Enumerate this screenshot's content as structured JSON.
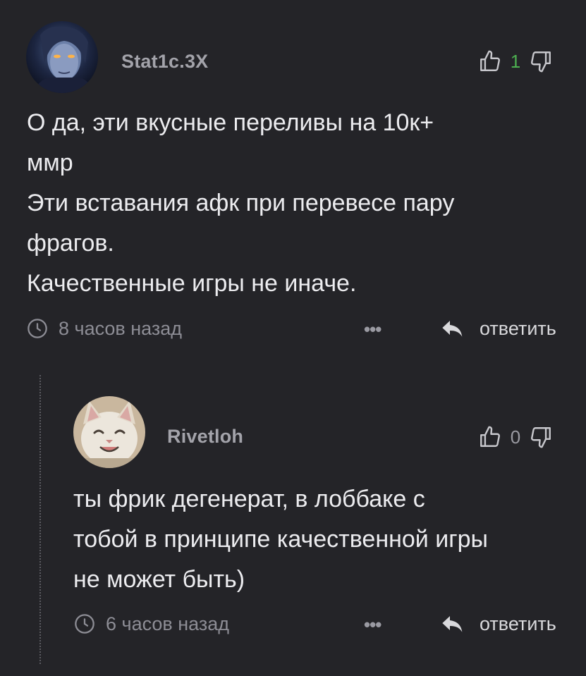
{
  "comments": [
    {
      "username": "Stat1c.3X",
      "rating": "1",
      "rating_color": "#4caf50",
      "text_lines": [
        "О да, эти вкусные переливы на 10к+",
        "ммр",
        "Эти вставания афк при перевесе пару",
        "фрагов.",
        "Качественные игры не иначе."
      ],
      "time": "8 часов назад",
      "more": "•••",
      "reply_label": "ответить",
      "icons": {
        "upvote": "thumbs-up-icon",
        "downvote": "thumbs-down-icon",
        "clock": "clock-icon",
        "reply": "reply-arrow-icon"
      }
    },
    {
      "username": "Rivetloh",
      "rating": "0",
      "rating_color": "#9a9aa2",
      "text_lines": [
        "ты фрик дегенерат, в лоббаке с",
        "тобой в принципе качественной игры",
        "не может быть)"
      ],
      "time": "6 часов назад",
      "more": "•••",
      "reply_label": "ответить",
      "icons": {
        "upvote": "thumbs-up-icon",
        "downvote": "thumbs-down-icon",
        "clock": "clock-icon",
        "reply": "reply-arrow-icon"
      }
    }
  ]
}
